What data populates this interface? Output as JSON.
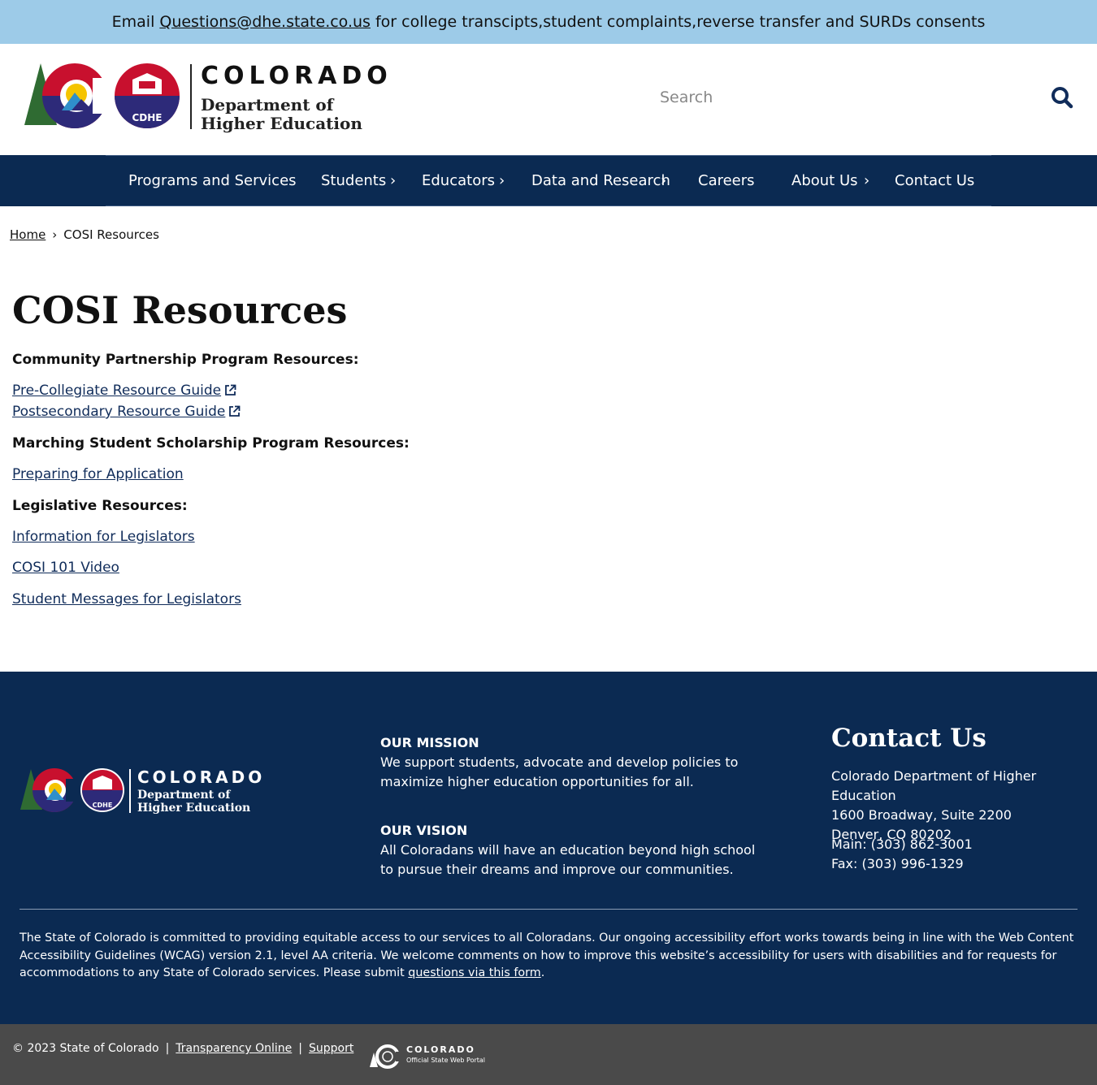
{
  "alert": {
    "prefix": "Email",
    "email": "Questions@dhe.state.co.us",
    "suffix": "for college transcipts,student complaints,reverse transfer and SURDs consents"
  },
  "header": {
    "logo_state": "COLORADO",
    "logo_dept_line1": "Department of",
    "logo_dept_line2": "Higher Education",
    "logo_badge": "CDHE",
    "search_placeholder": "Search"
  },
  "nav": {
    "items": [
      {
        "label": "Programs and Services"
      },
      {
        "label": "Students"
      },
      {
        "label": "Educators"
      },
      {
        "label": "Data and Research"
      },
      {
        "label": "Careers"
      },
      {
        "label": "About Us"
      },
      {
        "label": "Contact Us"
      }
    ],
    "chevron": "›"
  },
  "breadcrumb": {
    "home": "Home",
    "separator": "›",
    "current": "COSI Resources"
  },
  "page": {
    "title": "COSI Resources",
    "sections": {
      "community_heading": "Community Partnership Program Resources:",
      "pre_collegiate": "Pre-Collegiate Resource Guide",
      "postsecondary": "Postsecondary Resource Guide",
      "matching_heading": "Marching Student Scholarship Program Resources:",
      "preparing": "Preparing for Application",
      "legislative_heading": "Legislative Resources:",
      "info_legislators": "Information for Legislators",
      "cosi_video": "COSI 101 Video",
      "student_messages": "Student Messages for Legislators"
    }
  },
  "footer": {
    "logo_state": "COLORADO",
    "logo_dept_line1": "Department of",
    "logo_dept_line2": "Higher Education",
    "logo_badge": "CDHE",
    "mission_heading": "OUR MISSION",
    "mission_line1": "We support students, advocate and develop policies to",
    "mission_line2": "maximize higher education opportunities for all.",
    "vision_heading": "OUR VISION",
    "vision_line1": "All Coloradans will have an education beyond high school",
    "vision_line2": "to pursue their dreams and improve our communities.",
    "contact_title": "Contact Us",
    "address_line1": "Colorado Department of Higher Education",
    "address_line2": "1600 Broadway, Suite 2200",
    "address_line3": "Denver, CO 80202",
    "main_phone": "Main: (303) 862-3001",
    "fax": "Fax: (303) 996-1329",
    "accessibility_text": "The State of Colorado is committed to providing equitable access to our services to all Coloradans. Our ongoing accessibility effort works towards being in line with the Web Content Accessibility Guidelines (WCAG) version 2.1, level AA criteria. We welcome comments on how to improve this website’s accessibility for users with disabilities and for requests for accommodations to any State of Colorado services. Please submit",
    "accessibility_link": "questions via this form",
    "accessibility_end": "."
  },
  "bottom": {
    "copyright": "© 2023 State of Colorado",
    "separator": "|",
    "transparency": "Transparency Online",
    "support": "Support",
    "portal_state": "COLORADO",
    "portal_sub": "Official State Web Portal"
  },
  "colors": {
    "alert_bg": "#9dcbe8",
    "nav_bg": "#0b2a52",
    "footer_bg": "#0b2a52",
    "bottom_bg": "#4a4a4a",
    "link": "#102c5a"
  },
  "icons": [
    "search-icon",
    "external-link-icon",
    "chevron-right-icon",
    "colorado-c-logo",
    "cdhe-badge-logo"
  ]
}
